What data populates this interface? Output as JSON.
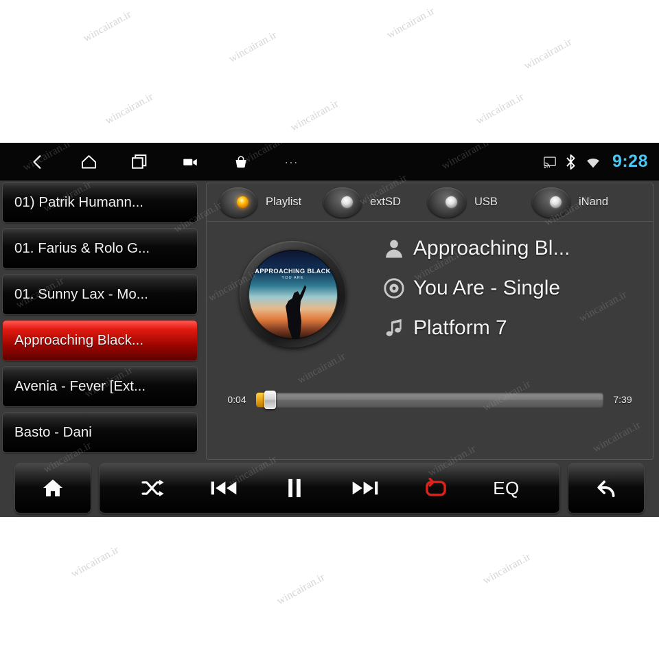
{
  "statusbar": {
    "nav": [
      {
        "name": "back-icon",
        "label": "Back"
      },
      {
        "name": "home-icon",
        "label": "Home"
      },
      {
        "name": "recents-icon",
        "label": "Recent apps"
      },
      {
        "name": "video-camera-icon",
        "label": "Camera"
      },
      {
        "name": "shopping-bag-icon",
        "label": "Apps"
      },
      {
        "name": "overflow-menu-icon",
        "label": "..."
      }
    ],
    "overflow_label": "...",
    "system_icons": [
      {
        "name": "cast-icon",
        "label": "Cast"
      },
      {
        "name": "bluetooth-icon",
        "label": "Bluetooth"
      },
      {
        "name": "wifi-icon",
        "label": "Wi-Fi"
      }
    ],
    "clock": "9:28",
    "clock_color": "#49c8f5"
  },
  "playlist": {
    "items": [
      {
        "label": "01) Patrik Humann...",
        "selected": false
      },
      {
        "label": "01. Farius & Rolo G...",
        "selected": false
      },
      {
        "label": "01. Sunny Lax - Mo...",
        "selected": false
      },
      {
        "label": "Approaching Black...",
        "selected": true
      },
      {
        "label": "Avenia - Fever [Ext...",
        "selected": false
      },
      {
        "label": "Basto - Dani",
        "selected": false
      }
    ],
    "selected_color": "#e01a10"
  },
  "sources": {
    "options": [
      {
        "label": "Playlist",
        "active": true
      },
      {
        "label": "extSD",
        "active": false
      },
      {
        "label": "USB",
        "active": false
      },
      {
        "label": "iNand",
        "active": false
      }
    ],
    "active_color": "#ffc107"
  },
  "now_playing": {
    "album_art": {
      "title": "APPROACHING BLACK",
      "subtitle": "YOU ARE"
    },
    "rows": [
      {
        "icon": "artist-icon",
        "text": "Approaching Bl..."
      },
      {
        "icon": "album-disc-icon",
        "text": "You Are - Single"
      },
      {
        "icon": "music-note-icon",
        "text": "Platform 7"
      }
    ],
    "seek": {
      "elapsed": "0:04",
      "duration": "7:39",
      "percent": 2.4
    }
  },
  "toolbar": {
    "home_label": "Home",
    "back_label": "Back",
    "eq_label": "EQ",
    "controls": [
      {
        "name": "shuffle-button",
        "label": "Shuffle",
        "active": false
      },
      {
        "name": "previous-button",
        "label": "Previous",
        "active": false
      },
      {
        "name": "pause-button",
        "label": "Pause",
        "active": false
      },
      {
        "name": "next-button",
        "label": "Next",
        "active": false
      },
      {
        "name": "repeat-button",
        "label": "Repeat",
        "active": true
      },
      {
        "name": "eq-button",
        "label": "EQ",
        "active": false
      }
    ],
    "repeat_color": "#e2211c"
  },
  "watermark": {
    "text": "wincairan.ir"
  }
}
